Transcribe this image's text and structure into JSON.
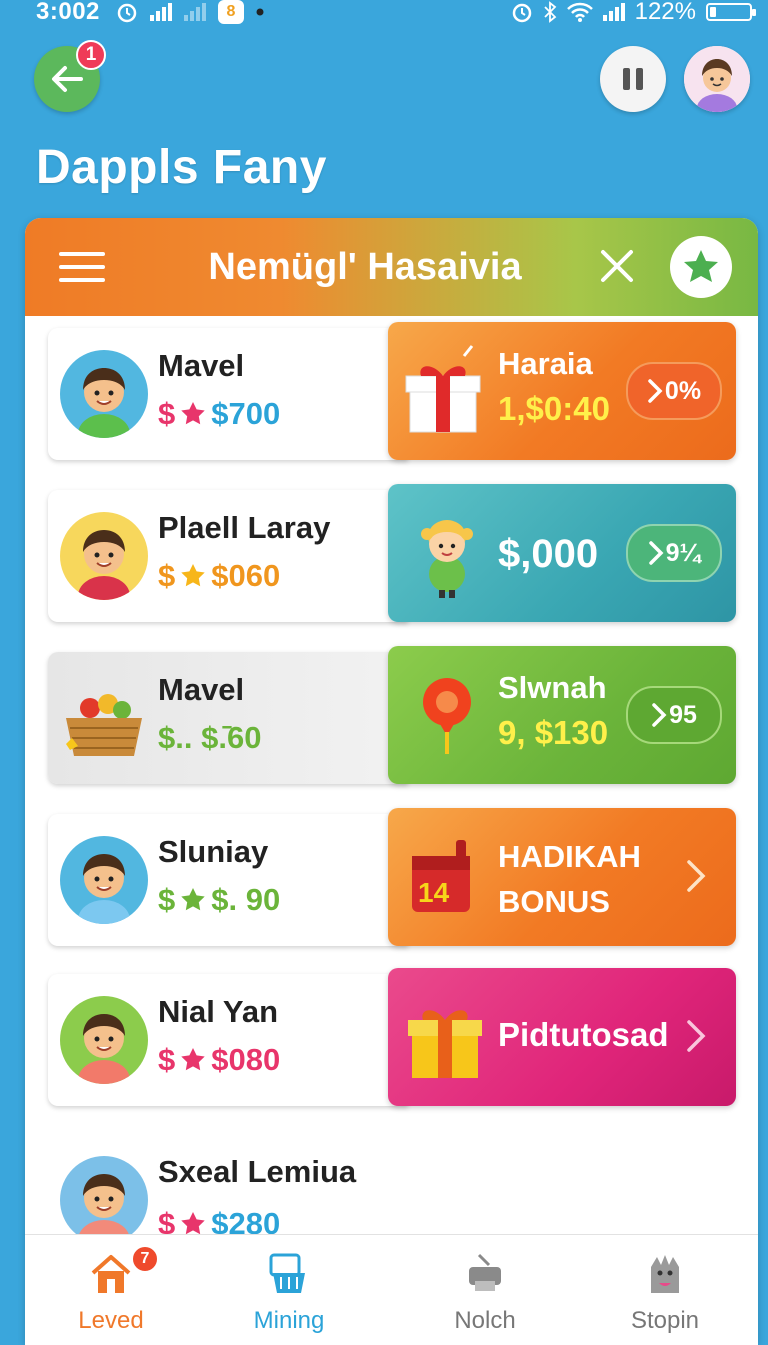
{
  "status_bar": {
    "time": "3:002",
    "battery": "122%",
    "battery_level": 0.15
  },
  "header": {
    "back_badge": "1",
    "app_title": "Dappls Fany"
  },
  "panel": {
    "title": "Nemügl' Hasaivia"
  },
  "colors": {
    "bg": "#3aa6dc",
    "orange": "#ef7b26",
    "green": "#7ab843",
    "teal": "#3aa7b3",
    "magenta": "#e0257a",
    "pink_price": "#e8356b",
    "blue_price": "#2ba3d8",
    "yellow": "#f7d51a"
  },
  "rows": [
    {
      "name": "Mavel",
      "price_prefix": "$",
      "star_icon": "star-icon",
      "price": "$700",
      "card_title": "Haraia",
      "card_value": "1,$0:40",
      "pill": "0%"
    },
    {
      "name": "Plaell Laray",
      "price_prefix": "$",
      "star_icon": "star-icon",
      "price": "$060",
      "card_big": "$,000",
      "pill": "9¼"
    },
    {
      "name": "Mavel",
      "price_prefix": "$..",
      "price": "$.̄60",
      "card_title": "Slwnah",
      "card_value": "9, $130",
      "pill": "95"
    },
    {
      "name": "Sluniay",
      "price_prefix": "$",
      "star_icon": "star-icon",
      "price": "$. 90",
      "card_bonus_1": "HADIKAH",
      "card_bonus_2": "BONUS",
      "card_number": "14"
    },
    {
      "name": "Nial Yan",
      "price_prefix": "$",
      "star_icon": "star-icon",
      "price": "$080",
      "card_label": "Pidtutosad"
    },
    {
      "name": "Sxeal Lemiua",
      "price_prefix": "$",
      "star_icon": "star-icon",
      "price": "$280"
    }
  ],
  "nav": [
    {
      "label": "Leved",
      "icon": "home-icon",
      "badge": "7"
    },
    {
      "label": "Mining",
      "icon": "basket-icon"
    },
    {
      "label": "Nolch",
      "icon": "printer-icon"
    },
    {
      "label": "Stopin",
      "icon": "monster-icon"
    }
  ]
}
